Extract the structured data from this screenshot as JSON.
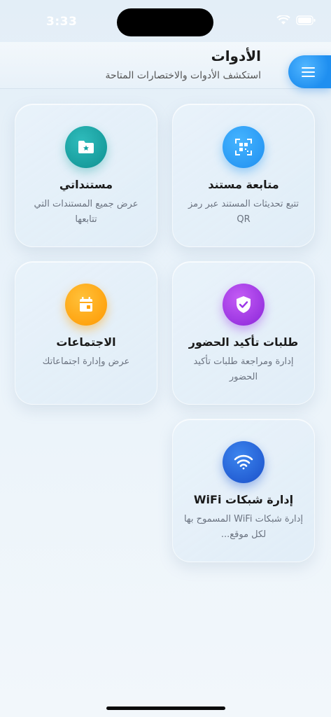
{
  "status_bar": {
    "time": "3:33"
  },
  "header": {
    "title": "الأدوات",
    "subtitle": "استكشف الأدوات والاختصارات المتاحة"
  },
  "menu_button": {
    "icon": "hamburger-menu-icon"
  },
  "cards": [
    {
      "title": "متابعة مستند",
      "description": "تتبع تحديثات المستند عبر رمز QR",
      "icon": "qr-scan-icon",
      "color": "#2196f3"
    },
    {
      "title": "مستنداتي",
      "description": "عرض جميع المستندات التي تتابعها",
      "icon": "folder-star-icon",
      "color": "#14a3a3"
    },
    {
      "title": "طلبات تأكيد الحضور",
      "description": "إدارة ومراجعة طلبات تأكيد الحضور",
      "icon": "shield-check-icon",
      "color": "#9c35e8"
    },
    {
      "title": "الاجتماعات",
      "description": "عرض وإدارة اجتماعاتك",
      "icon": "calendar-icon",
      "color": "#ffa000"
    },
    {
      "title": "إدارة شبكات WiFi",
      "description": "إدارة شبكات WiFi المسموح بها لكل موقع...",
      "icon": "wifi-icon",
      "color": "#1f62d8"
    }
  ]
}
